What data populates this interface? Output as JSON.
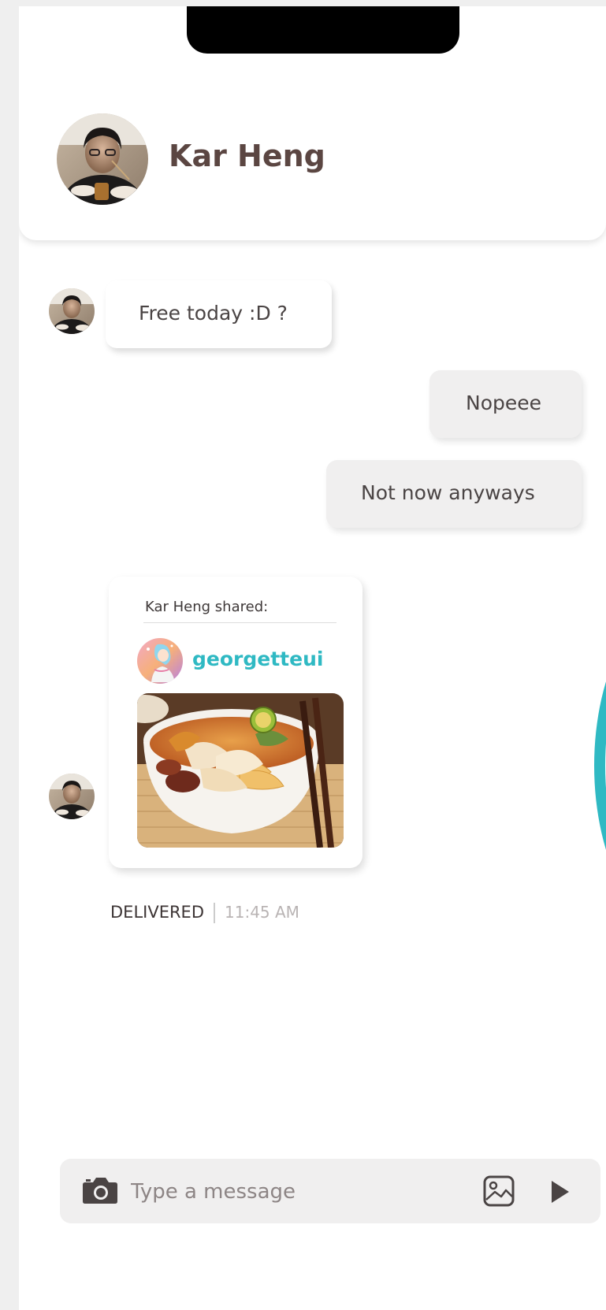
{
  "header": {
    "contact_name": "Kar Heng"
  },
  "messages": [
    {
      "direction": "incoming",
      "text": "Free today :D ?"
    },
    {
      "direction": "outgoing",
      "text": "Nopeee"
    },
    {
      "direction": "outgoing",
      "text": "Not now anyways"
    }
  ],
  "shared_post": {
    "label": "Kar Heng shared:",
    "username": "georgetteui",
    "image": "noodle-soup-photo"
  },
  "status": {
    "delivered": "DELIVERED",
    "time": "11:45 AM"
  },
  "composer": {
    "placeholder": "Type a message"
  },
  "icons": {
    "camera": "camera-icon",
    "gallery": "image-gallery-icon",
    "send": "send-icon"
  },
  "colors": {
    "accent": "#2fb9c3",
    "name": "#5b4642",
    "bubble_out": "#f0efef"
  }
}
